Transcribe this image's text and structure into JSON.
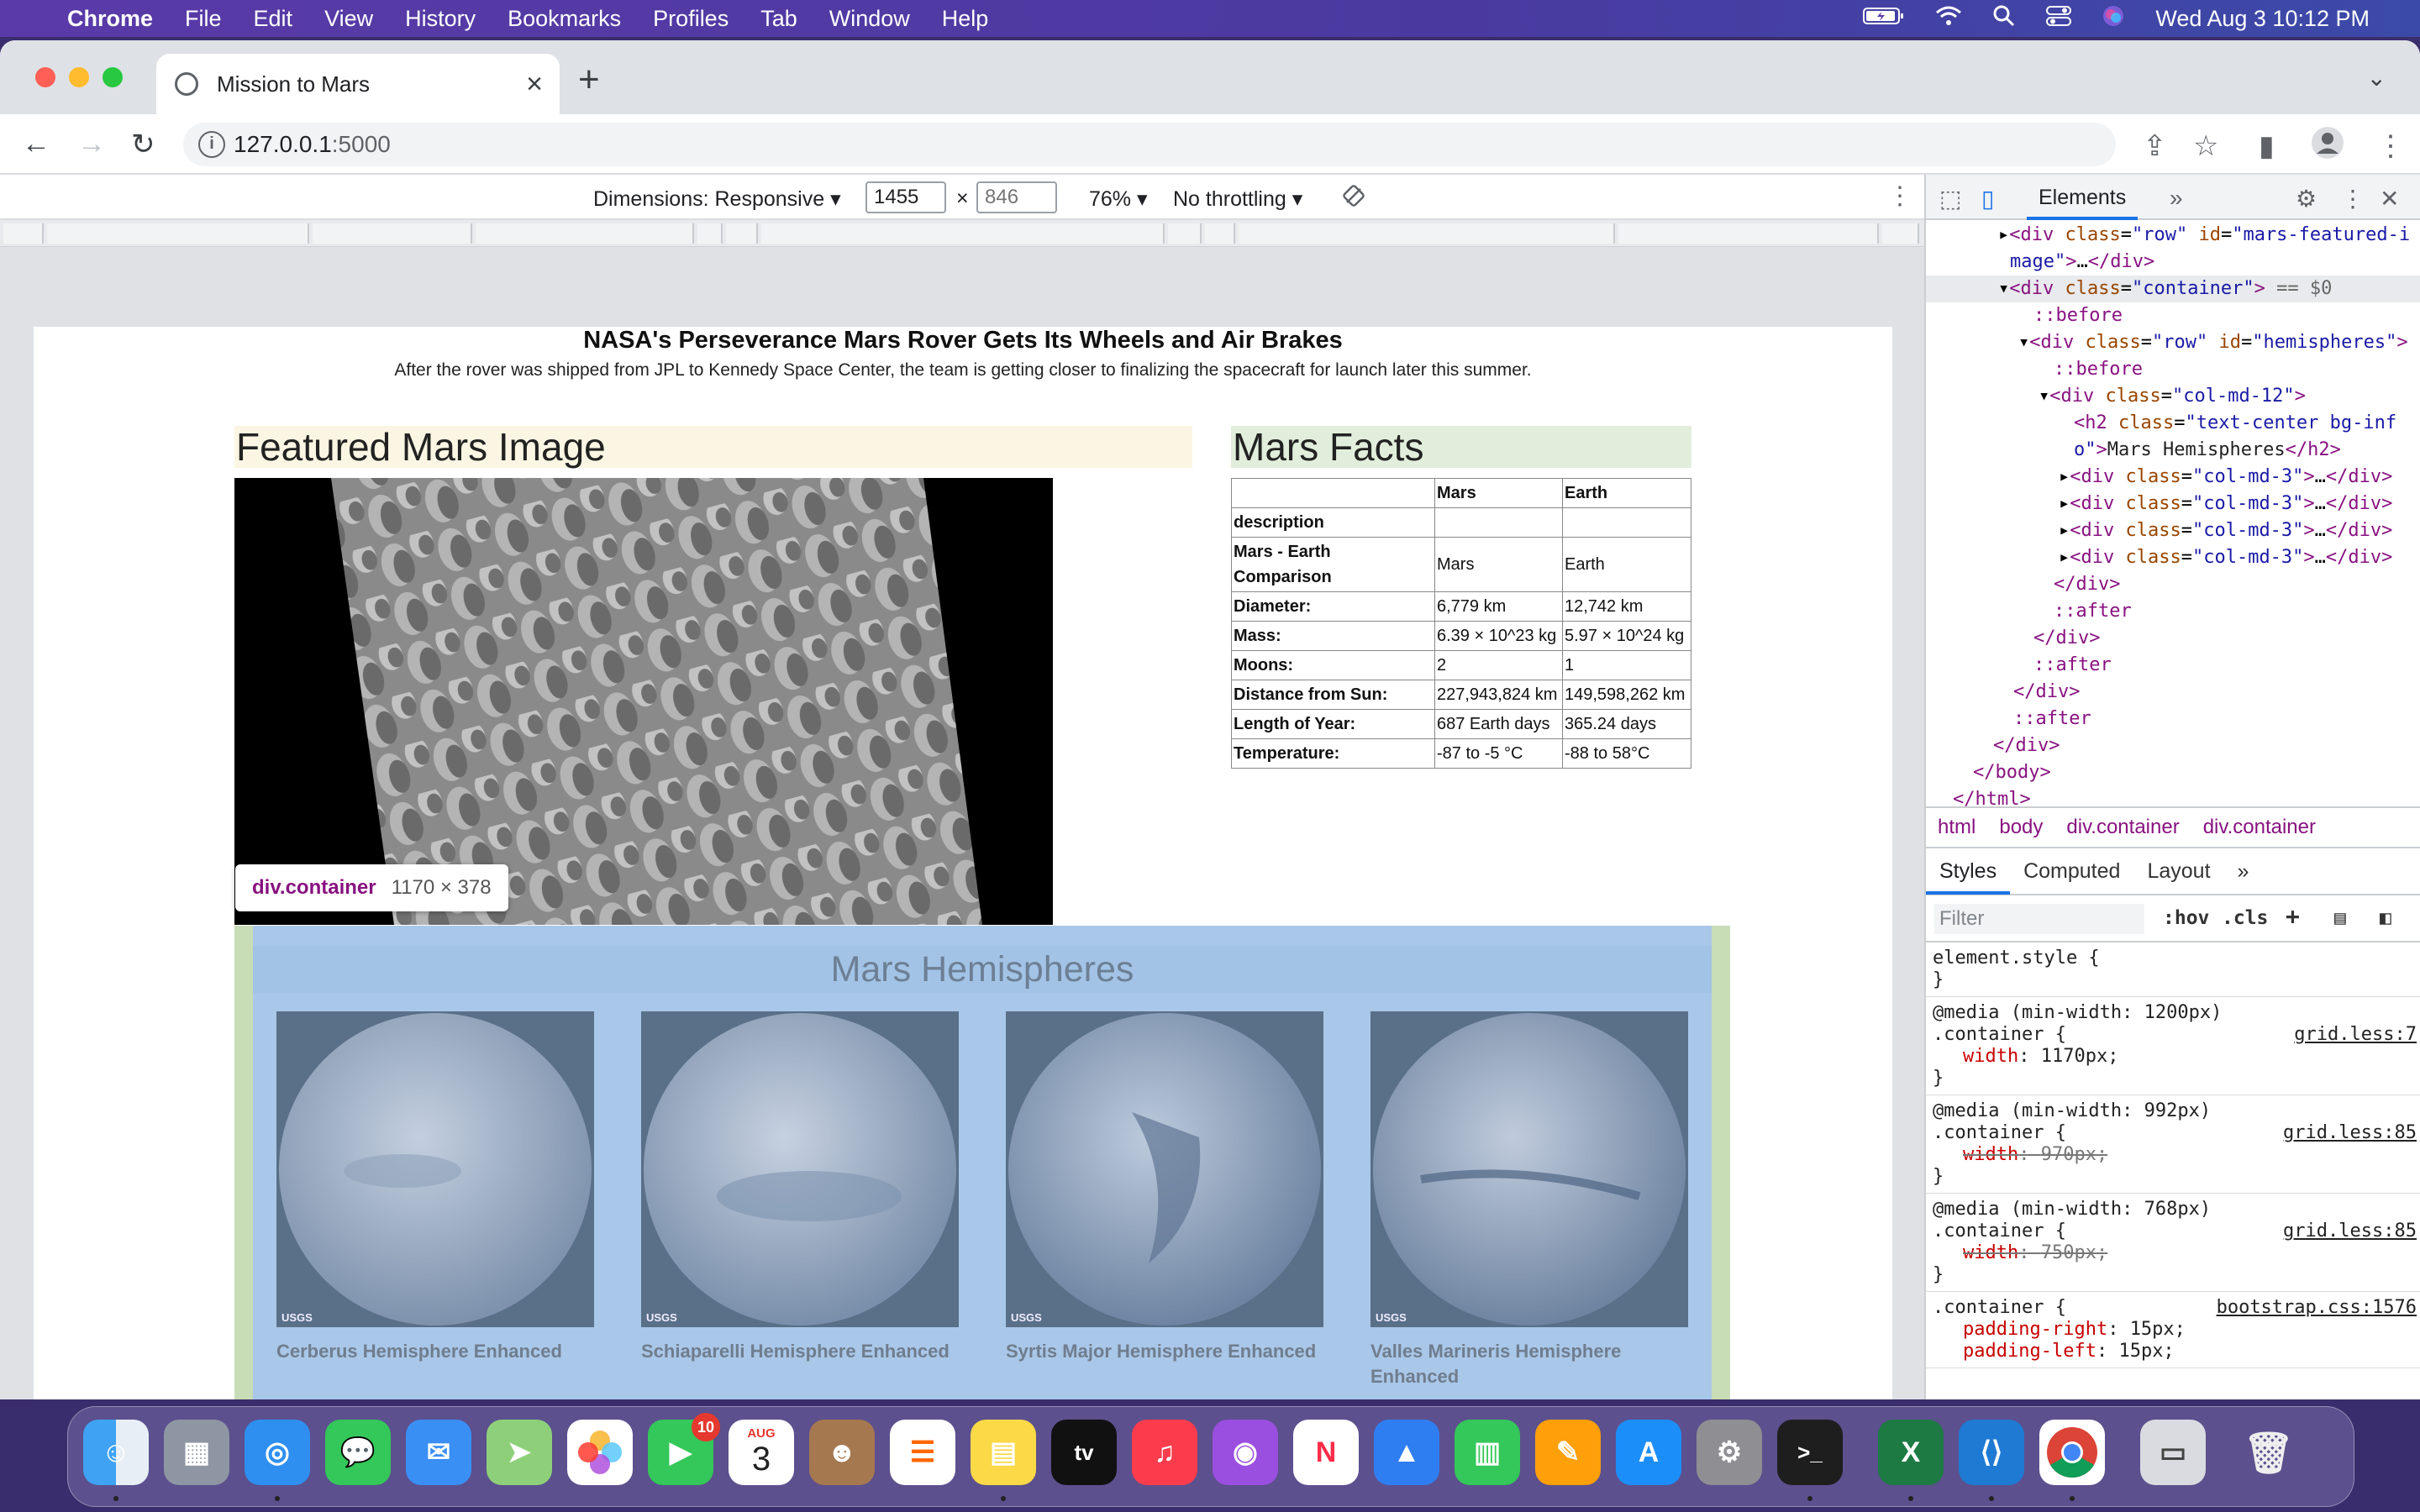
{
  "menubar": {
    "app": "Chrome",
    "items": [
      "File",
      "Edit",
      "View",
      "History",
      "Bookmarks",
      "Profiles",
      "Tab",
      "Window",
      "Help"
    ],
    "clock": "Wed Aug 3  10:12 PM"
  },
  "browser": {
    "tab_title": "Mission to Mars",
    "url_host": "127.0.0.1",
    "url_port": ":5000"
  },
  "device_toolbar": {
    "dimensions_label": "Dimensions: Responsive",
    "width": "1455",
    "height_placeholder": "846",
    "times": "×",
    "zoom": "76%",
    "throttle": "No throttling"
  },
  "page": {
    "news_title": "NASA's Perseverance Mars Rover Gets Its Wheels and Air Brakes",
    "news_teaser": "After the rover was shipped from JPL to Kennedy Space Center, the team is getting closer to finalizing the spacecraft for launch later this summer.",
    "featured_title": "Featured Mars Image",
    "facts_title": "Mars Facts",
    "facts_table": {
      "headers": [
        "",
        "Mars",
        "Earth"
      ],
      "rows": [
        [
          "description",
          "",
          ""
        ],
        [
          "Mars - Earth Comparison",
          "Mars",
          "Earth"
        ],
        [
          "Diameter:",
          "6,779 km",
          "12,742 km"
        ],
        [
          "Mass:",
          "6.39 × 10^23 kg",
          "5.97 × 10^24 kg"
        ],
        [
          "Moons:",
          "2",
          "1"
        ],
        [
          "Distance from Sun:",
          "227,943,824 km",
          "149,598,262 km"
        ],
        [
          "Length of Year:",
          "687 Earth days",
          "365.24 days"
        ],
        [
          "Temperature:",
          "-87 to -5 °C",
          "-88 to 58°C"
        ]
      ]
    },
    "tooltip": {
      "tag": "div.container",
      "dims": "1170 × 378"
    },
    "hemispheres_title": "Mars Hemispheres",
    "hemispheres": [
      {
        "caption": "Cerberus Hemisphere Enhanced",
        "credit": "USGS"
      },
      {
        "caption": "Schiaparelli Hemisphere Enhanced",
        "credit": "USGS"
      },
      {
        "caption": "Syrtis Major Hemisphere Enhanced",
        "credit": "USGS"
      },
      {
        "caption": "Valles Marineris Hemisphere Enhanced",
        "credit": "USGS"
      }
    ]
  },
  "devtools": {
    "panel_tab": "Elements",
    "breadcrumbs": [
      "html",
      "body",
      "div.container",
      "div.container"
    ],
    "style_tabs": [
      "Styles",
      "Computed",
      "Layout"
    ],
    "filter_placeholder": "Filter",
    "hov": ":hov",
    "cls": ".cls",
    "dom_h2_text": "Mars Hemispheres",
    "selected_marker": "== $0",
    "styles": {
      "element_style": "element.style {",
      "media1": "@media (min-width: 1200px)",
      "media2": "@media (min-width: 992px)",
      "media3": "@media (min-width: 768px)",
      "selector": ".container {",
      "src1": "grid.less:7",
      "src2": "grid.less:85",
      "src3": "grid.less:85",
      "src4": "bootstrap.css:1576",
      "width1": "1170px;",
      "width2": "970px;",
      "width3": "750px;",
      "pad_r": "15px;",
      "pad_l": "15px;"
    }
  },
  "dock": {
    "calendar_month": "AUG",
    "calendar_day": "3",
    "facetime_badge": "10"
  },
  "colors": {
    "menubar": "#5a3aa8",
    "featured_bg": "#faf6e3",
    "facts_bg": "#e1eedb",
    "hemis_bg": "#a9c7e8",
    "devtools_accent": "#1a73e8"
  }
}
